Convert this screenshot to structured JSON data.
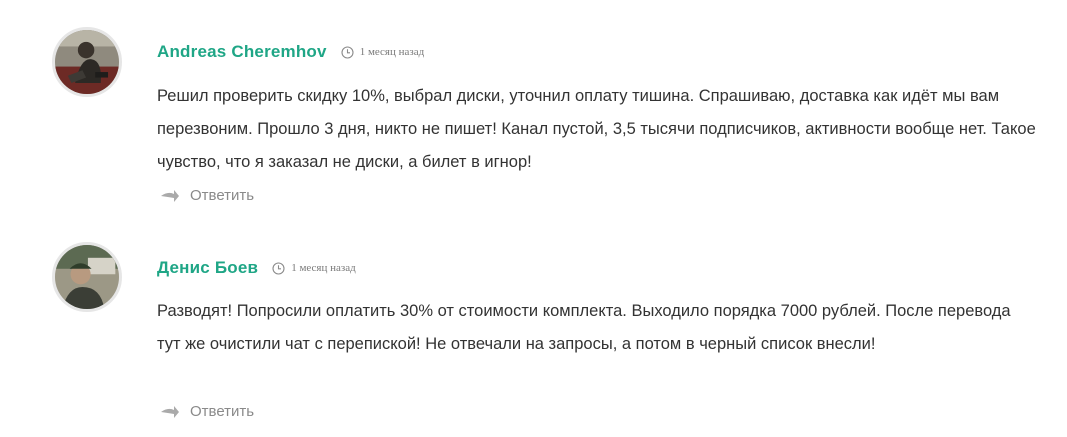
{
  "comments": [
    {
      "author": "Andreas Cheremhov",
      "time": "1 месяц назад",
      "text": "Решил проверить скидку 10%, выбрал диски, уточнил оплату тишина. Спрашиваю, доставка как идёт мы вам перезвоним. Прошло 3 дня, никто не пишет! Канал пустой, 3,5 тысячи подписчиков, активности вообще нет. Такое чувство, что я заказал не диски, а билет в игнор!",
      "reply_label": "Ответить"
    },
    {
      "author": "Денис Боев",
      "time": "1 месяц назад",
      "text": "Разводят! Попросили оплатить 30% от стоимости комплекта. Выходило порядка 7000 рублей. После перевода тут же очистили чат с перепиской! Не отвечали на запросы, а потом в черный список внесли!",
      "reply_label": "Ответить"
    }
  ],
  "colors": {
    "author": "#1fa686",
    "text": "#333333",
    "muted": "#8a8a8a"
  },
  "icons": {
    "time": "clock-icon",
    "reply": "reply-arrow-icon"
  }
}
